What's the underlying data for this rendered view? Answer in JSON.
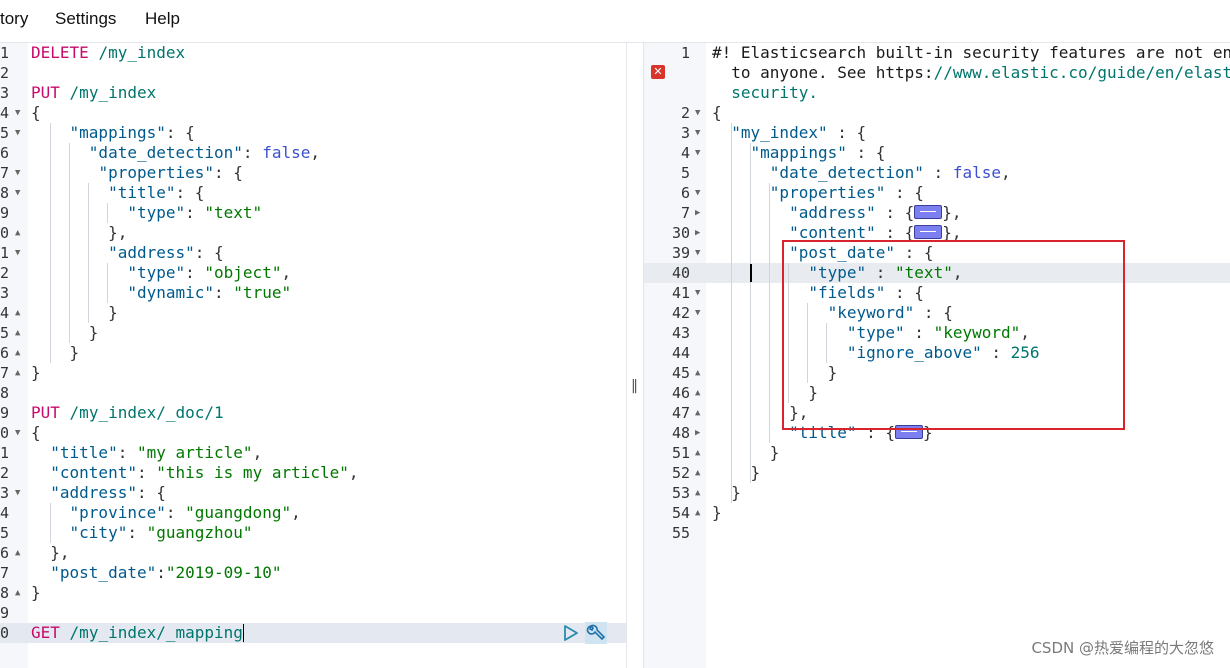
{
  "menu": {
    "history_label": "tory",
    "settings_label": "Settings",
    "help_label": "Help"
  },
  "left_editor": {
    "line_numbers": [
      "1",
      "2",
      "3",
      "4",
      "5",
      "6",
      "7",
      "8",
      "9",
      "0",
      "1",
      "2",
      "3",
      "4",
      "5",
      "6",
      "7",
      "8",
      "9",
      "0",
      "1",
      "2",
      "3",
      "4",
      "5",
      "6",
      "7",
      "8",
      "9",
      "0"
    ],
    "lines": [
      "DELETE /my_index",
      "",
      "PUT /my_index",
      "{",
      "  \"mappings\": {",
      "    \"date_detection\": false,",
      "     \"properties\": {",
      "      \"title\": {",
      "        \"type\": \"text\"",
      "      },",
      "      \"address\": {",
      "        \"type\": \"object\",",
      "        \"dynamic\": \"true\"",
      "      }",
      "    }",
      "  }",
      "}",
      "",
      "PUT /my_index/_doc/1",
      "{",
      "  \"title\": \"my article\",",
      "  \"content\": \"this is my article\",",
      "  \"address\": {",
      "    \"province\": \"guangdong\",",
      "    \"city\": \"guangzhou\"",
      "  },",
      "  \"post_date\":\"2019-09-10\"",
      "}",
      "",
      "GET /my_index/_mapping"
    ]
  },
  "right_editor": {
    "line_numbers": [
      "1",
      "",
      "",
      "2",
      "3",
      "4",
      "5",
      "6",
      "7",
      "30",
      "39",
      "40",
      "41",
      "42",
      "43",
      "44",
      "45",
      "46",
      "47",
      "48",
      "51",
      "52",
      "53",
      "54",
      "55"
    ],
    "warning_line1": "#! Elasticsearch built-in security features are not en",
    "warning_line2": "  to anyone. See https://www.elastic.co/guide/en/elast",
    "warning_line3": "  security.",
    "lines": [
      "{",
      "  \"my_index\" : {",
      "    \"mappings\" : {",
      "      \"date_detection\" : false,",
      "      \"properties\" : {",
      "        \"address\" : {",
      "        \"content\" : {",
      "        \"post_date\" : {",
      "          \"type\" : \"text\",",
      "          \"fields\" : {",
      "            \"keyword\" : {",
      "              \"type\" : \"keyword\",",
      "              \"ignore_above\" : 256",
      "            }",
      "          }",
      "        },",
      "        \"title\" : {",
      "      }",
      "    }",
      "  }",
      "}"
    ]
  },
  "watermark": "CSDN @热爱编程的大忽悠"
}
